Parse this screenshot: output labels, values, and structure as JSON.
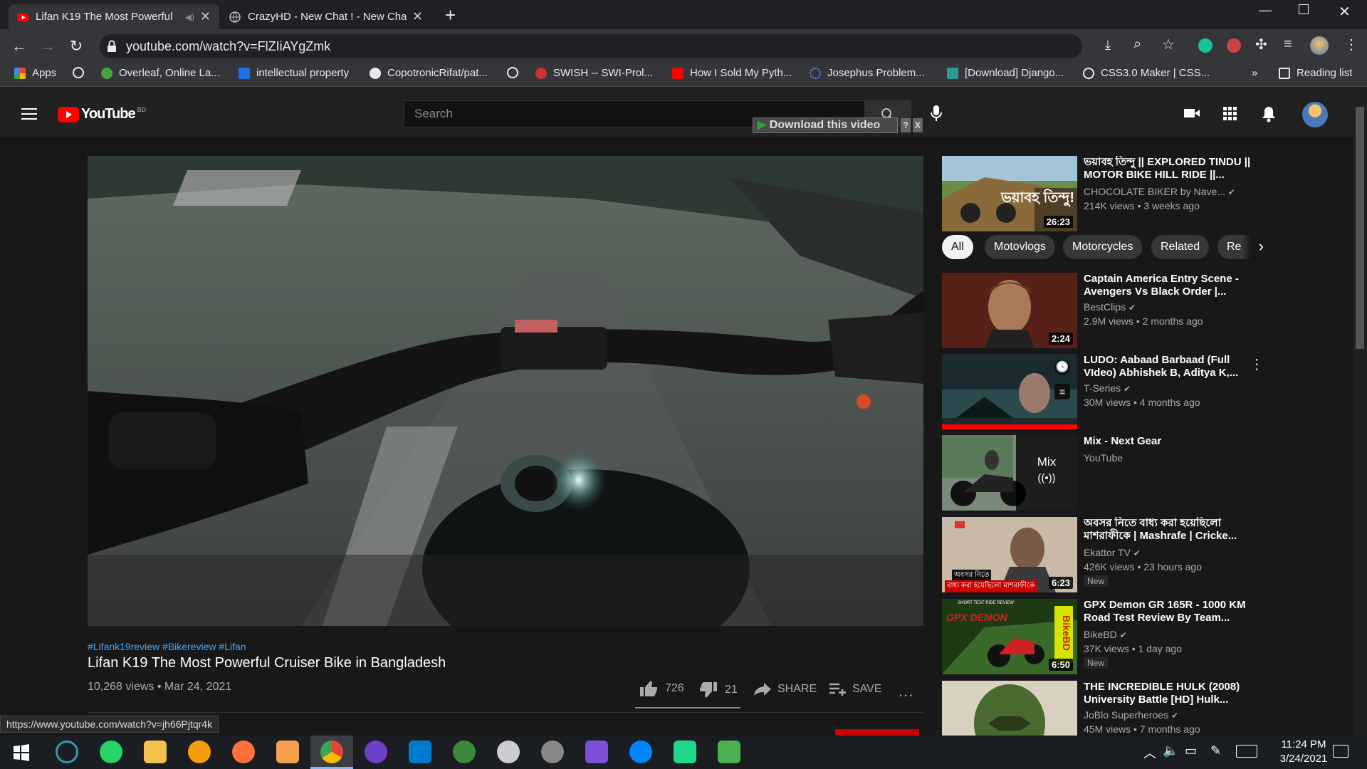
{
  "browser": {
    "tabs": [
      {
        "title": "Lifan K19 The Most Powerful",
        "active": true
      },
      {
        "title": "CrazyHD - New Chat ! - New Cha",
        "active": false
      }
    ],
    "url": "youtube.com/watch?v=FlZIiAYgZmk",
    "bookmarks": [
      "Apps",
      "Overleaf, Online La...",
      "intellectual property",
      "CopotronicRifat/pat...",
      "SWISH -- SWI-Prol...",
      "How I Sold My Pyth...",
      "Josephus Problem...",
      "[Download] Django...",
      "CSS3.0 Maker | CSS..."
    ],
    "more": "»",
    "reading_list": "Reading list"
  },
  "youtube": {
    "logo": "YouTube",
    "country": "BD",
    "search_placeholder": "Search",
    "download_bar": "Download this video",
    "download_bar_help": "?",
    "download_bar_close": "X"
  },
  "video": {
    "hashtags": "#Lifank19review #Bikereview #Lifan",
    "title": "Lifan K19 The Most Powerful Cruiser Bike in Bangladesh",
    "views_date": "10,268 views • Mar 24, 2021",
    "likes": "726",
    "dislikes": "21",
    "share": "SHARE",
    "save": "SAVE",
    "more": "..."
  },
  "chips": [
    "All",
    "Motovlogs",
    "Motorcycles",
    "Related",
    "Re"
  ],
  "recommendations": [
    {
      "title": "ভয়াবহ তিন্দু || EXPLORED TINDU || MOTOR BIKE HILL RIDE ||...",
      "channel": "CHOCOLATE BIKER by Nave...",
      "verified": true,
      "meta": "214K views • 3 weeks ago",
      "duration": "26:23",
      "thumb_text": "ভয়াবহ তিন্দু!",
      "badge": ""
    },
    {
      "title": "Captain America Entry Scene - Avengers Vs Black Order |...",
      "channel": "BestClips",
      "verified": true,
      "meta": "2.9M views • 2 months ago",
      "duration": "2:24",
      "badge": ""
    },
    {
      "title": "LUDO: Aabaad Barbaad (Full VIdeo) Abhishek B, Aditya K,...",
      "channel": "T-Series",
      "verified": true,
      "meta": "30M views • 4 months ago",
      "duration": "",
      "badge": ""
    },
    {
      "title": "Mix - Next Gear",
      "channel": "YouTube",
      "verified": false,
      "meta": "",
      "duration": "",
      "mix": "Mix",
      "badge": ""
    },
    {
      "title": "অবসর নিতে বাধ্য করা হয়েছিলো মাশরাফীকে | Mashrafe | Cricke...",
      "channel": "Ekattor TV",
      "verified": true,
      "meta": "426K views • 23 hours ago",
      "duration": "6:23",
      "badge": "New",
      "thumb_text_1": "অবসর নিতে",
      "thumb_text_2": "বাধ্য করা হয়েছিলো মাশরাফীকে"
    },
    {
      "title": "GPX Demon GR 165R - 1000 KM Road Test Review By Team...",
      "channel": "BikeBD",
      "verified": true,
      "meta": "37K views • 1 day ago",
      "duration": "6:50",
      "badge": "New",
      "thumb_text_1": "SHORT TEST RIDE REVIEW",
      "thumb_text_2": "GPX DEMON",
      "thumb_text_3": "BikeBD"
    },
    {
      "title": "THE INCREDIBLE HULK (2008) University Battle [HD] Hulk...",
      "channel": "JoBlo Superheroes",
      "verified": true,
      "meta": "45M views • 7 months ago",
      "duration": "",
      "badge": ""
    }
  ],
  "status_url": "https://www.youtube.com/watch?v=jh66Pjtqr4k",
  "taskbar": {
    "time": "11:24 PM",
    "date": "3/24/2021"
  },
  "colors": {
    "youtube_red": "#ff0000",
    "link_blue": "#3ea6ff",
    "dark_bg": "#181818"
  }
}
